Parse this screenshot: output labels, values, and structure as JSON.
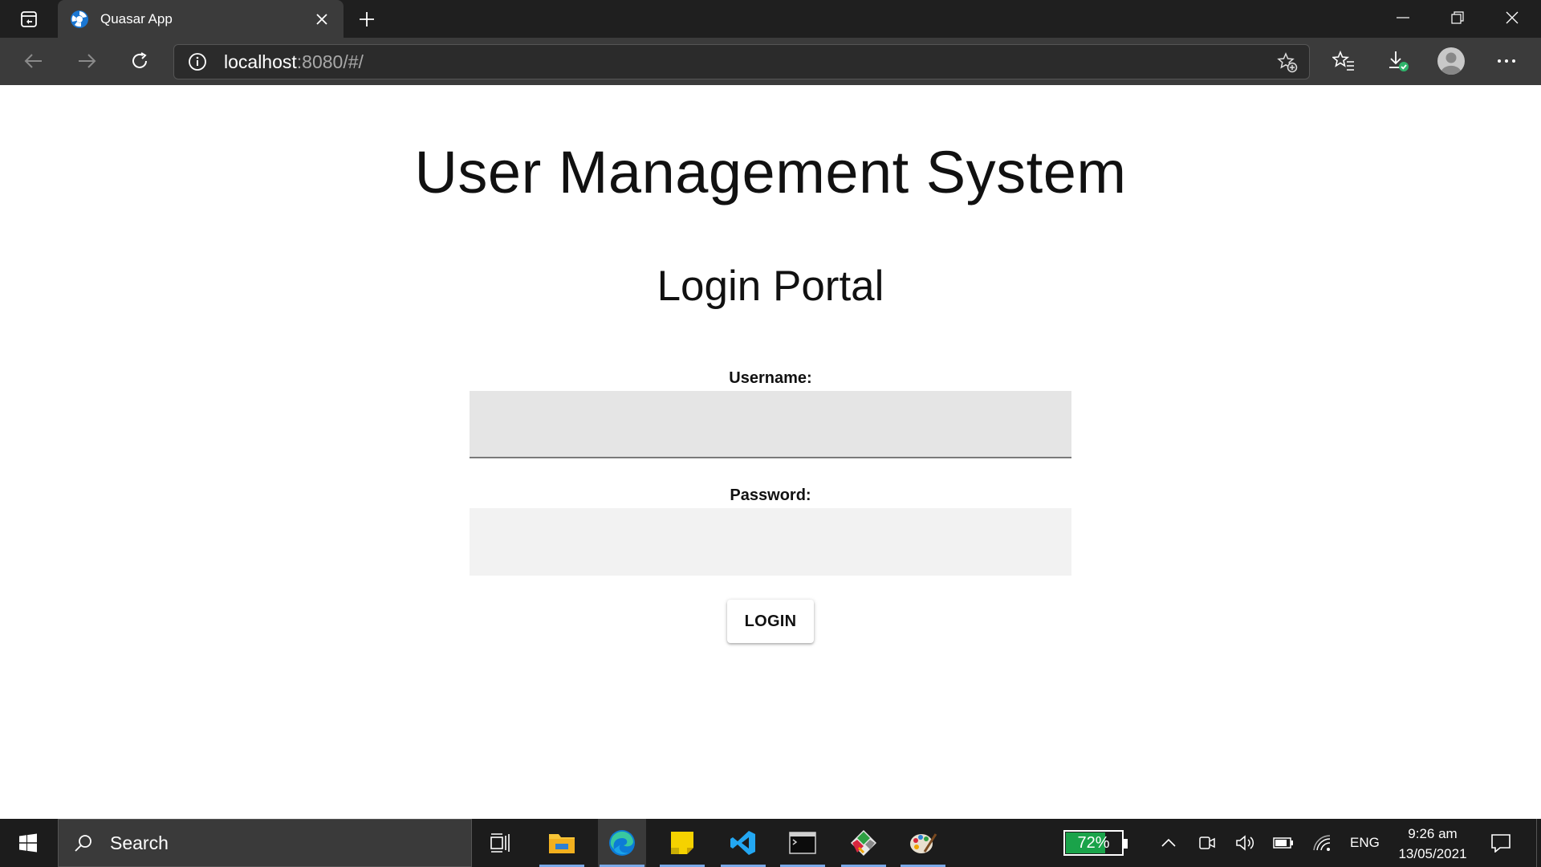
{
  "browser": {
    "tab": {
      "title": "Quasar App"
    },
    "address": {
      "host": "localhost",
      "rest": ":8080/#/"
    }
  },
  "page": {
    "app_title": "User Management System",
    "portal_title": "Login Portal",
    "username_label": "Username:",
    "username_value": "",
    "password_label": "Password:",
    "password_value": "",
    "login_button": "LOGIN"
  },
  "taskbar": {
    "search_text": "Search",
    "battery_percent": 72,
    "battery_label": "72%",
    "language": "ENG",
    "time": "9:26 am",
    "date": "13/05/2021",
    "pinned_apps": [
      "task-view",
      "file-explorer",
      "edge",
      "sticky-notes",
      "vscode",
      "terminal",
      "git",
      "paint"
    ]
  },
  "colors": {
    "tabbar": "#1f1f1f",
    "toolbar": "#3b3b3b",
    "taskbar": "#1c1c1c",
    "username_field": "#e5e5e5",
    "password_field": "#f2f2f2",
    "battery_fill": "#1aa34a",
    "taskbar_underline": "#7aa9e8"
  }
}
